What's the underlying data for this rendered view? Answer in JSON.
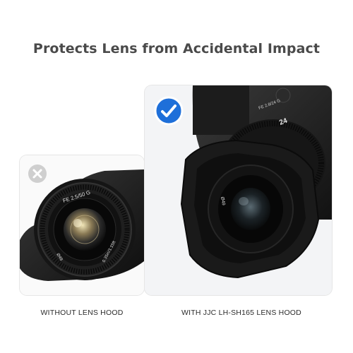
{
  "headline": "Protects Lens from Accidental Impact",
  "comparison": {
    "left": {
      "caption": "WITHOUT LENS HOOD",
      "status_icon": "x-icon",
      "lens_markings": {
        "model": "FE 2.5/50 G",
        "focus": "0.35m/1.15ft",
        "filter": "Ø49"
      }
    },
    "right": {
      "caption": "WITH JJC LH-SH165 LENS HOOD",
      "status_icon": "checkmark-icon",
      "lens_markings": {
        "model": "FE 2.8/24 G",
        "focal": "24",
        "filter": "Ø49"
      }
    }
  },
  "colors": {
    "accent_blue": "#1e6fd9",
    "badge_grey": "#cfcfcf"
  }
}
